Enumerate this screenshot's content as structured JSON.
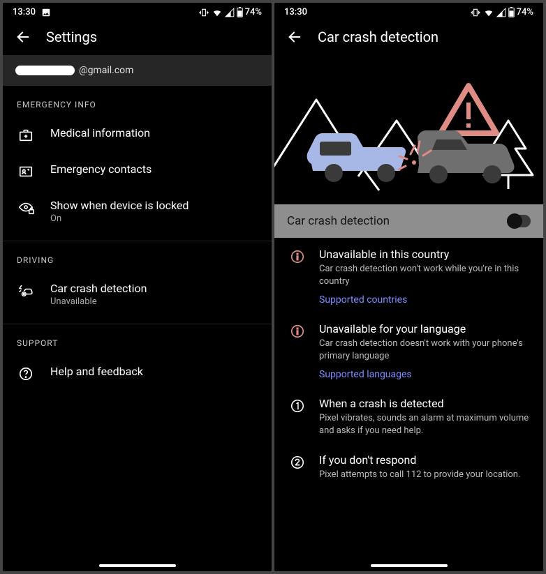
{
  "status": {
    "time": "13:30",
    "battery": "74%"
  },
  "left": {
    "title": "Settings",
    "account_suffix": "@gmail.com",
    "sections": {
      "emergency": {
        "header": "EMERGENCY INFO",
        "medical": "Medical information",
        "contacts": "Emergency contacts",
        "show_locked_title": "Show when device is locked",
        "show_locked_sub": "On"
      },
      "driving": {
        "header": "DRIVING",
        "crash_title": "Car crash detection",
        "crash_sub": "Unavailable"
      },
      "support": {
        "header": "SUPPORT",
        "help": "Help and feedback"
      }
    }
  },
  "right": {
    "title": "Car crash detection",
    "toggle_label": "Car crash detection",
    "items": {
      "country": {
        "title": "Unavailable in this country",
        "desc": "Car crash detection won't work while you're in this country",
        "link": "Supported countries"
      },
      "language": {
        "title": "Unavailable for your language",
        "desc": "Car crash detection doesn't work with your phone's primary language",
        "link": "Supported languages"
      },
      "detected": {
        "title": "When a crash is detected",
        "desc": "Pixel vibrates, sounds an alarm at maximum volume and asks if you need help."
      },
      "respond": {
        "title": "If you don't respond",
        "desc": "Pixel attempts to call 112 to provide your location."
      }
    }
  }
}
